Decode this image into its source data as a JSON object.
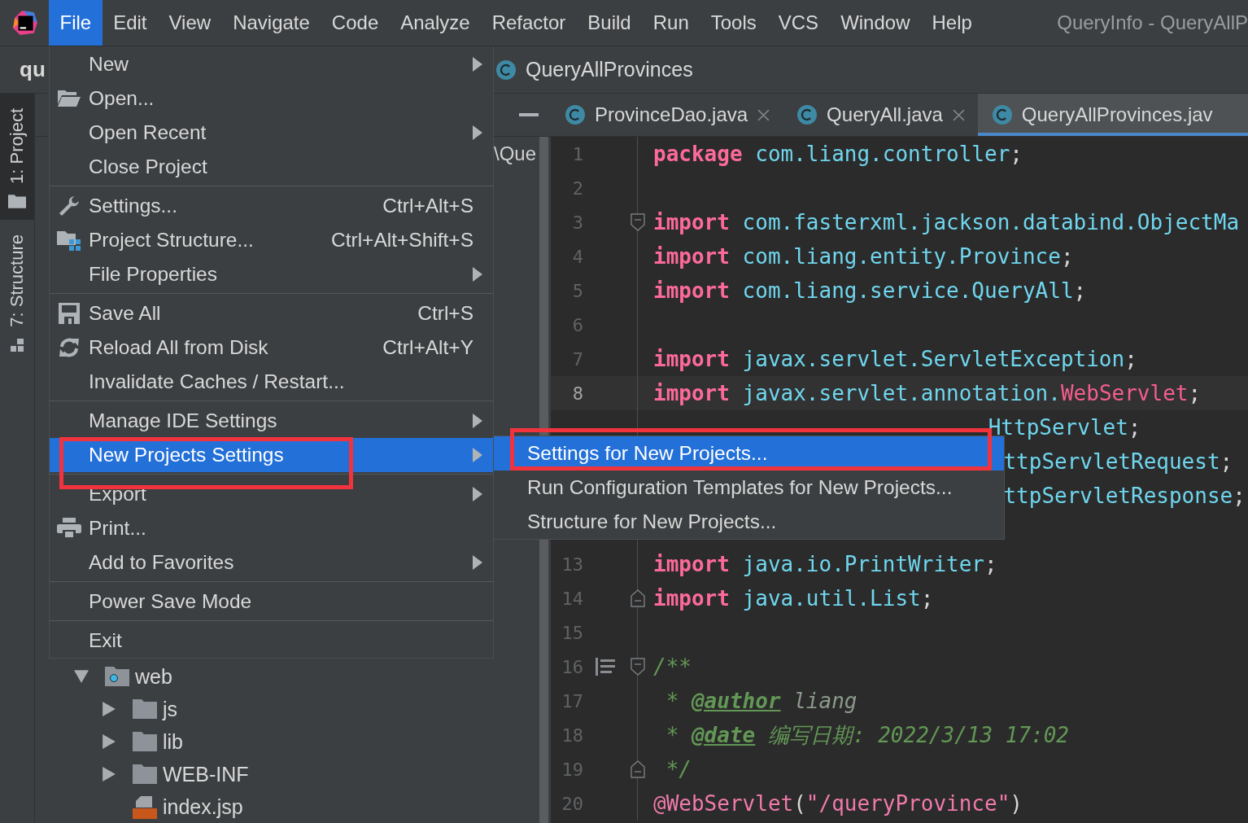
{
  "window": {
    "title": "QueryInfo - QueryAllP"
  },
  "menu_bar": {
    "items": [
      {
        "label": "File",
        "selected": true
      },
      {
        "label": "Edit",
        "selected": false
      },
      {
        "label": "View",
        "selected": false
      },
      {
        "label": "Navigate",
        "selected": false
      },
      {
        "label": "Code",
        "selected": false
      },
      {
        "label": "Analyze",
        "selected": false
      },
      {
        "label": "Refactor",
        "selected": false
      },
      {
        "label": "Build",
        "selected": false
      },
      {
        "label": "Run",
        "selected": false
      },
      {
        "label": "Tools",
        "selected": false
      },
      {
        "label": "VCS",
        "selected": false
      },
      {
        "label": "Window",
        "selected": false
      },
      {
        "label": "Help",
        "selected": false
      }
    ]
  },
  "navigation_bar": {
    "project": "qu",
    "breadcrumb": "QueryAllProvinces"
  },
  "tool_tabs": [
    {
      "label": "1: Project",
      "selected": true,
      "kind": "project"
    },
    {
      "label": "7: Structure",
      "selected": false,
      "kind": "structure"
    }
  ],
  "project_tree": {
    "items": [
      {
        "label": "\\Que",
        "kind": "root"
      },
      {
        "label": "web",
        "kind": "web-folder",
        "expanded": true,
        "children": [
          {
            "label": "js",
            "kind": "folder",
            "expanded": false
          },
          {
            "label": "lib",
            "kind": "folder",
            "expanded": false
          },
          {
            "label": "WEB-INF",
            "kind": "folder",
            "expanded": false
          },
          {
            "label": "index.jsp",
            "kind": "jsp"
          }
        ]
      }
    ]
  },
  "editor": {
    "tabs": [
      {
        "label": "ProvinceDao.java",
        "selected": false
      },
      {
        "label": "QueryAll.java",
        "selected": false
      },
      {
        "label": "QueryAllProvinces.jav",
        "selected": true
      }
    ],
    "lines": [
      {
        "number": "1",
        "tokens": [
          {
            "kind": "kw",
            "text": "package"
          },
          {
            "kind": "id",
            "text": " com.liang.controller"
          },
          {
            "kind": "p",
            "text": ";"
          }
        ]
      },
      {
        "number": "2"
      },
      {
        "number": "3",
        "kind": "fold-start",
        "tokens": [
          {
            "kind": "kw",
            "text": "import"
          },
          {
            "kind": "id",
            "text": " com.fasterxml.jackson.databind.ObjectMa"
          }
        ]
      },
      {
        "number": "4",
        "tokens": [
          {
            "kind": "kw",
            "text": "import"
          },
          {
            "kind": "id",
            "text": " com.liang.entity.Province"
          },
          {
            "kind": "p",
            "text": ";"
          }
        ]
      },
      {
        "number": "5",
        "tokens": [
          {
            "kind": "kw",
            "text": "import"
          },
          {
            "kind": "id",
            "text": " com.liang.service.QueryAll"
          },
          {
            "kind": "p",
            "text": ";"
          }
        ]
      },
      {
        "number": "6"
      },
      {
        "number": "7",
        "tokens": [
          {
            "kind": "kw",
            "text": "import"
          },
          {
            "kind": "id",
            "text": " javax.servlet.ServletException"
          },
          {
            "kind": "p",
            "text": ";"
          }
        ]
      },
      {
        "number": "8",
        "current": true,
        "tokens": [
          {
            "kind": "kw",
            "text": "import"
          },
          {
            "kind": "id",
            "text": " javax.servlet.annotation."
          },
          {
            "kind": "hi",
            "text": "WebServlet"
          },
          {
            "kind": "p",
            "text": ";"
          }
        ]
      },
      {
        "kind": "partly-covered",
        "tokens": [
          {
            "kind": "id",
            "text": "HttpServlet"
          },
          {
            "kind": "p",
            "text": ";"
          }
        ]
      },
      {
        "kind": "covered",
        "tokens": [
          {
            "kind": "id",
            "text": "ttpServletRequest"
          },
          {
            "kind": "p",
            "text": ";"
          }
        ]
      },
      {
        "kind": "covered",
        "tokens": [
          {
            "kind": "id",
            "text": "ttpServletResponse"
          },
          {
            "kind": "p",
            "text": ";"
          }
        ]
      },
      {
        "kind": "covered"
      },
      {
        "number": "13",
        "tokens": [
          {
            "kind": "kw",
            "text": "import"
          },
          {
            "kind": "id",
            "text": " java.io.PrintWriter"
          },
          {
            "kind": "p",
            "text": ";"
          }
        ]
      },
      {
        "number": "14",
        "kind": "fold-end",
        "tokens": [
          {
            "kind": "kw",
            "text": "import"
          },
          {
            "kind": "id",
            "text": " java.util.List"
          },
          {
            "kind": "p",
            "text": ";"
          }
        ]
      },
      {
        "number": "15"
      },
      {
        "number": "16",
        "kind": "doc-start",
        "tokens": [
          {
            "kind": "doc",
            "text": "/**"
          }
        ]
      },
      {
        "number": "17",
        "tokens": [
          {
            "kind": "doc",
            "text": " * "
          },
          {
            "kind": "tag",
            "text": "@author"
          },
          {
            "kind": "val",
            "text": " liang"
          }
        ]
      },
      {
        "number": "18",
        "tokens": [
          {
            "kind": "doc",
            "text": " * "
          },
          {
            "kind": "tag",
            "text": "@date"
          },
          {
            "kind": "doc",
            "text": " 编写日期: 2022/3/13 17:02"
          }
        ]
      },
      {
        "number": "19",
        "kind": "fold-end",
        "tokens": [
          {
            "kind": "doc",
            "text": " */"
          }
        ]
      },
      {
        "number": "20",
        "tokens": [
          {
            "kind": "ann",
            "text": "@WebServlet"
          },
          {
            "kind": "p",
            "text": "("
          },
          {
            "kind": "str",
            "text": "\"/queryProvince\""
          },
          {
            "kind": "p",
            "text": ")"
          }
        ]
      }
    ]
  },
  "file_menu": {
    "groups": [
      {
        "items": [
          {
            "label": "New",
            "submenu": true,
            "selected": false,
            "framed": false
          },
          {
            "label": "Open...",
            "kind": "open-folder",
            "selected": false,
            "framed": false
          },
          {
            "label": "Open Recent",
            "submenu": true,
            "selected": false,
            "framed": false
          },
          {
            "label": "Close Project",
            "selected": false,
            "framed": false
          }
        ]
      },
      {
        "items": [
          {
            "label": "Settings...",
            "kind": "wrench",
            "shortcut": "Ctrl+Alt+S",
            "selected": false,
            "framed": false
          },
          {
            "label": "Project Structure...",
            "kind": "structure",
            "shortcut": "Ctrl+Alt+Shift+S",
            "selected": false,
            "framed": false
          },
          {
            "label": "File Properties",
            "submenu": true,
            "selected": false,
            "framed": false
          }
        ]
      },
      {
        "items": [
          {
            "label": "Save All",
            "kind": "save",
            "shortcut": "Ctrl+S",
            "selected": false,
            "framed": false
          },
          {
            "label": "Reload All from Disk",
            "kind": "reload",
            "shortcut": "Ctrl+Alt+Y",
            "selected": false,
            "framed": false
          },
          {
            "label": "Invalidate Caches / Restart...",
            "selected": false,
            "framed": false
          }
        ]
      },
      {
        "items": [
          {
            "label": "Manage IDE Settings",
            "submenu": true,
            "selected": false,
            "framed": false
          },
          {
            "label": "New Projects Settings",
            "submenu": true,
            "selected": true,
            "framed": true
          }
        ]
      },
      {
        "items": [
          {
            "label": "Export",
            "submenu": true,
            "selected": false,
            "framed": false
          },
          {
            "label": "Print...",
            "kind": "printer",
            "selected": false,
            "framed": false
          },
          {
            "label": "Add to Favorites",
            "submenu": true,
            "selected": false,
            "framed": false
          }
        ]
      },
      {
        "items": [
          {
            "label": "Power Save Mode",
            "selected": false,
            "framed": false
          }
        ]
      },
      {
        "items": [
          {
            "label": "Exit",
            "selected": false,
            "framed": false
          }
        ]
      }
    ]
  },
  "submenu": {
    "items": [
      {
        "label": "Settings for New Projects...",
        "selected": true,
        "framed": true
      },
      {
        "label": "Run Configuration Templates for New Projects...",
        "selected": false,
        "framed": false
      },
      {
        "label": "Structure for New Projects...",
        "selected": false,
        "framed": false
      }
    ]
  }
}
